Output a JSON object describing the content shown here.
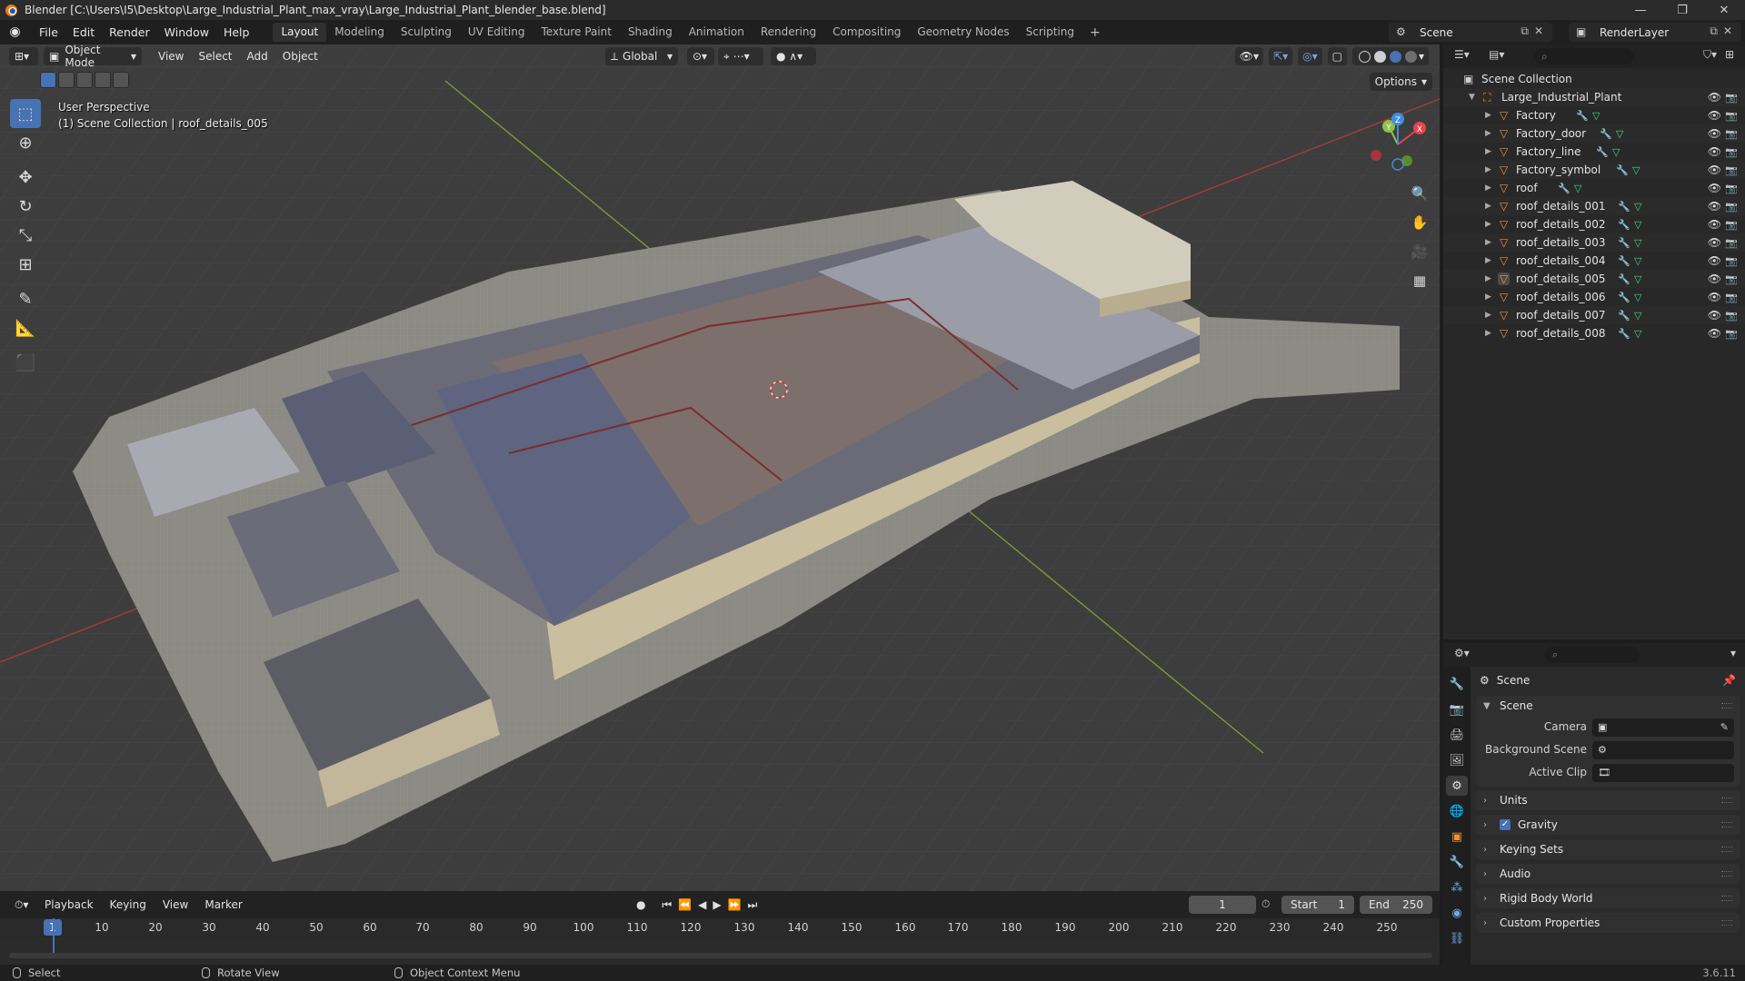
{
  "titlebar": {
    "title": "Blender [C:\\Users\\I5\\Desktop\\Large_Industrial_Plant_max_vray\\Large_Industrial_Plant_blender_base.blend]",
    "minimize": "—",
    "maximize": "❐",
    "close": "✕"
  },
  "menu": [
    "File",
    "Edit",
    "Render",
    "Window",
    "Help"
  ],
  "workspaces": [
    "Layout",
    "Modeling",
    "Sculpting",
    "UV Editing",
    "Texture Paint",
    "Shading",
    "Animation",
    "Rendering",
    "Compositing",
    "Geometry Nodes",
    "Scripting"
  ],
  "active_workspace": "Layout",
  "scene_name": "Scene",
  "render_layer": "RenderLayer",
  "viewport": {
    "mode": "Object Mode",
    "menu": [
      "View",
      "Select",
      "Add",
      "Object"
    ],
    "orientation": "Global",
    "options": "Options",
    "info_line1": "User Perspective",
    "info_line2": "(1) Scene Collection | roof_details_005",
    "gizmo_axes": {
      "x": "X",
      "y": "Y",
      "z": "Z"
    }
  },
  "colors": {
    "accent": "#4772b3",
    "axis_x": "#e2464f",
    "axis_y": "#8bc34a",
    "axis_z": "#3f8ddc",
    "object_icon": "#e8943a",
    "mesh_icon": "#3ddc84",
    "modifier_icon": "#6fc1ff"
  },
  "outliner": {
    "search_placeholder": "",
    "root": "Scene Collection",
    "collection": "Large_Industrial_Plant",
    "objects": [
      "Factory",
      "Factory_door",
      "Factory_line",
      "Factory_symbol",
      "roof",
      "roof_details_001",
      "roof_details_002",
      "roof_details_003",
      "roof_details_004",
      "roof_details_005",
      "roof_details_006",
      "roof_details_007",
      "roof_details_008"
    ],
    "active_object": "roof_details_005"
  },
  "properties": {
    "context": "Scene",
    "scene_panel": "Scene",
    "camera_label": "Camera",
    "background_scene_label": "Background Scene",
    "active_clip_label": "Active Clip",
    "collapsed_panels": [
      "Units",
      "Gravity",
      "Keying Sets",
      "Audio",
      "Rigid Body World",
      "Custom Properties"
    ],
    "gravity_checked": true
  },
  "timeline": {
    "menu": [
      "Playback",
      "Keying",
      "View",
      "Marker"
    ],
    "current_frame": "1",
    "start_label": "Start",
    "start": "1",
    "end_label": "End",
    "end": "250",
    "ruler": [
      "1",
      "10",
      "20",
      "30",
      "40",
      "50",
      "60",
      "70",
      "80",
      "90",
      "100",
      "110",
      "120",
      "130",
      "140",
      "150",
      "160",
      "170",
      "180",
      "190",
      "200",
      "210",
      "220",
      "230",
      "240",
      "250"
    ]
  },
  "statusbar": {
    "select": "Select",
    "rotate": "Rotate View",
    "context_menu": "Object Context Menu",
    "version": "3.6.11"
  }
}
